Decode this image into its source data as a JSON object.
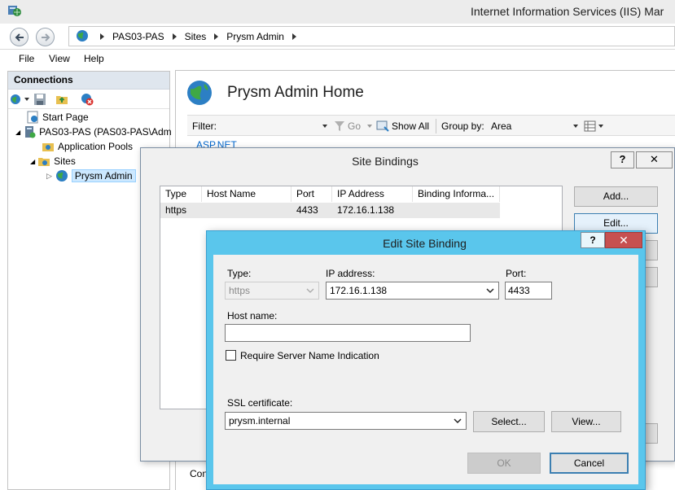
{
  "window": {
    "title": "Internet Information Services (IIS) Mar"
  },
  "address": {
    "breadcrumbs": [
      "PAS03-PAS",
      "Sites",
      "Prysm Admin"
    ]
  },
  "menu": [
    "File",
    "View",
    "Help"
  ],
  "connections": {
    "header": "Connections",
    "tree": [
      {
        "label": "Start Page"
      },
      {
        "label": "PAS03-PAS (PAS03-PAS\\Adm"
      },
      {
        "label": "Application Pools"
      },
      {
        "label": "Sites"
      },
      {
        "label": "Prysm Admin"
      }
    ]
  },
  "main": {
    "title": "Prysm Admin Home",
    "filter_label": "Filter:",
    "go_label": "Go",
    "show_all_label": "Show All",
    "group_by_label": "Group by:",
    "group_by_value": "Area",
    "section_link": "ASP.NET",
    "bottom_text": "Con"
  },
  "site_bindings": {
    "title": "Site Bindings",
    "help": "?",
    "close": "✕",
    "columns": [
      "Type",
      "Host Name",
      "Port",
      "IP Address",
      "Binding Informa..."
    ],
    "rows": [
      [
        "https",
        "",
        "4433",
        "172.16.1.138",
        ""
      ]
    ],
    "buttons": {
      "add": "Add...",
      "edit": "Edit..."
    }
  },
  "edit_binding": {
    "title": "Edit Site Binding",
    "help": "?",
    "close": "✕",
    "type_label": "Type:",
    "type_value": "https",
    "ip_label": "IP address:",
    "ip_value": "172.16.1.138",
    "port_label": "Port:",
    "port_value": "4433",
    "host_label": "Host name:",
    "host_value": "",
    "sni_label": "Require Server Name Indication",
    "sni_checked": false,
    "ssl_label": "SSL certificate:",
    "ssl_value": "prysm.internal",
    "select_button": "Select...",
    "view_button": "View...",
    "ok_button": "OK",
    "cancel_button": "Cancel"
  },
  "colors": {
    "dialog_accent": "#5ac6ec",
    "close_red": "#c75050",
    "selection": "#cce8ff",
    "link": "#0066cc"
  },
  "icons": [
    "iis-app-icon",
    "back-arrow-icon",
    "forward-arrow-icon",
    "globe-icon",
    "save-icon",
    "folder-up-icon",
    "disconnect-icon",
    "server-icon",
    "app-pool-icon",
    "sites-folder-icon",
    "funnel-icon",
    "show-all-icon",
    "view-toggle-icon",
    "dropdown-arrow-icon"
  ]
}
